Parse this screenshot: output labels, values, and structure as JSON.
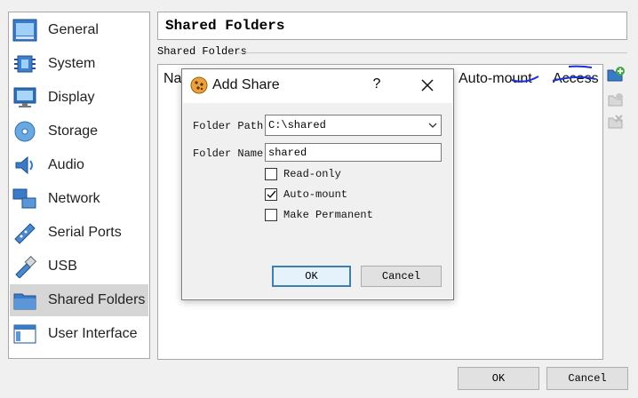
{
  "sidebar": {
    "items": [
      {
        "label": "General",
        "icon": "general-icon"
      },
      {
        "label": "System",
        "icon": "system-icon"
      },
      {
        "label": "Display",
        "icon": "display-icon"
      },
      {
        "label": "Storage",
        "icon": "storage-icon"
      },
      {
        "label": "Audio",
        "icon": "audio-icon"
      },
      {
        "label": "Network",
        "icon": "network-icon"
      },
      {
        "label": "Serial Ports",
        "icon": "serial-ports-icon"
      },
      {
        "label": "USB",
        "icon": "usb-icon"
      },
      {
        "label": "Shared Folders",
        "icon": "shared-folders-icon"
      },
      {
        "label": "User Interface",
        "icon": "user-interface-icon"
      }
    ],
    "selected": "Shared Folders"
  },
  "page": {
    "title": "Shared Folders",
    "group_label": "Shared Folders"
  },
  "table": {
    "columns": [
      "Na",
      "Auto-mount",
      "Access"
    ]
  },
  "toolbar": {
    "buttons": [
      "add-share-icon",
      "edit-share-icon",
      "remove-share-icon"
    ]
  },
  "dialog": {
    "title": "Add Share",
    "help": "?",
    "folder_path_label": "Folder Path:",
    "folder_path_value": "C:\\shared",
    "folder_name_label": "Folder Name:",
    "folder_name_value": "shared",
    "read_only_label": "Read-only",
    "read_only_checked": false,
    "auto_mount_label": "Auto-mount",
    "auto_mount_checked": true,
    "make_permanent_label": "Make Permanent",
    "make_permanent_checked": false,
    "ok_label": "OK",
    "cancel_label": "Cancel"
  },
  "footer": {
    "ok_label": "OK",
    "cancel_label": "Cancel"
  },
  "colors": {
    "selected_bg": "#d6d6d6",
    "annotation_blue": "#1a2fd6",
    "default_button_border": "#3c7fb1"
  }
}
